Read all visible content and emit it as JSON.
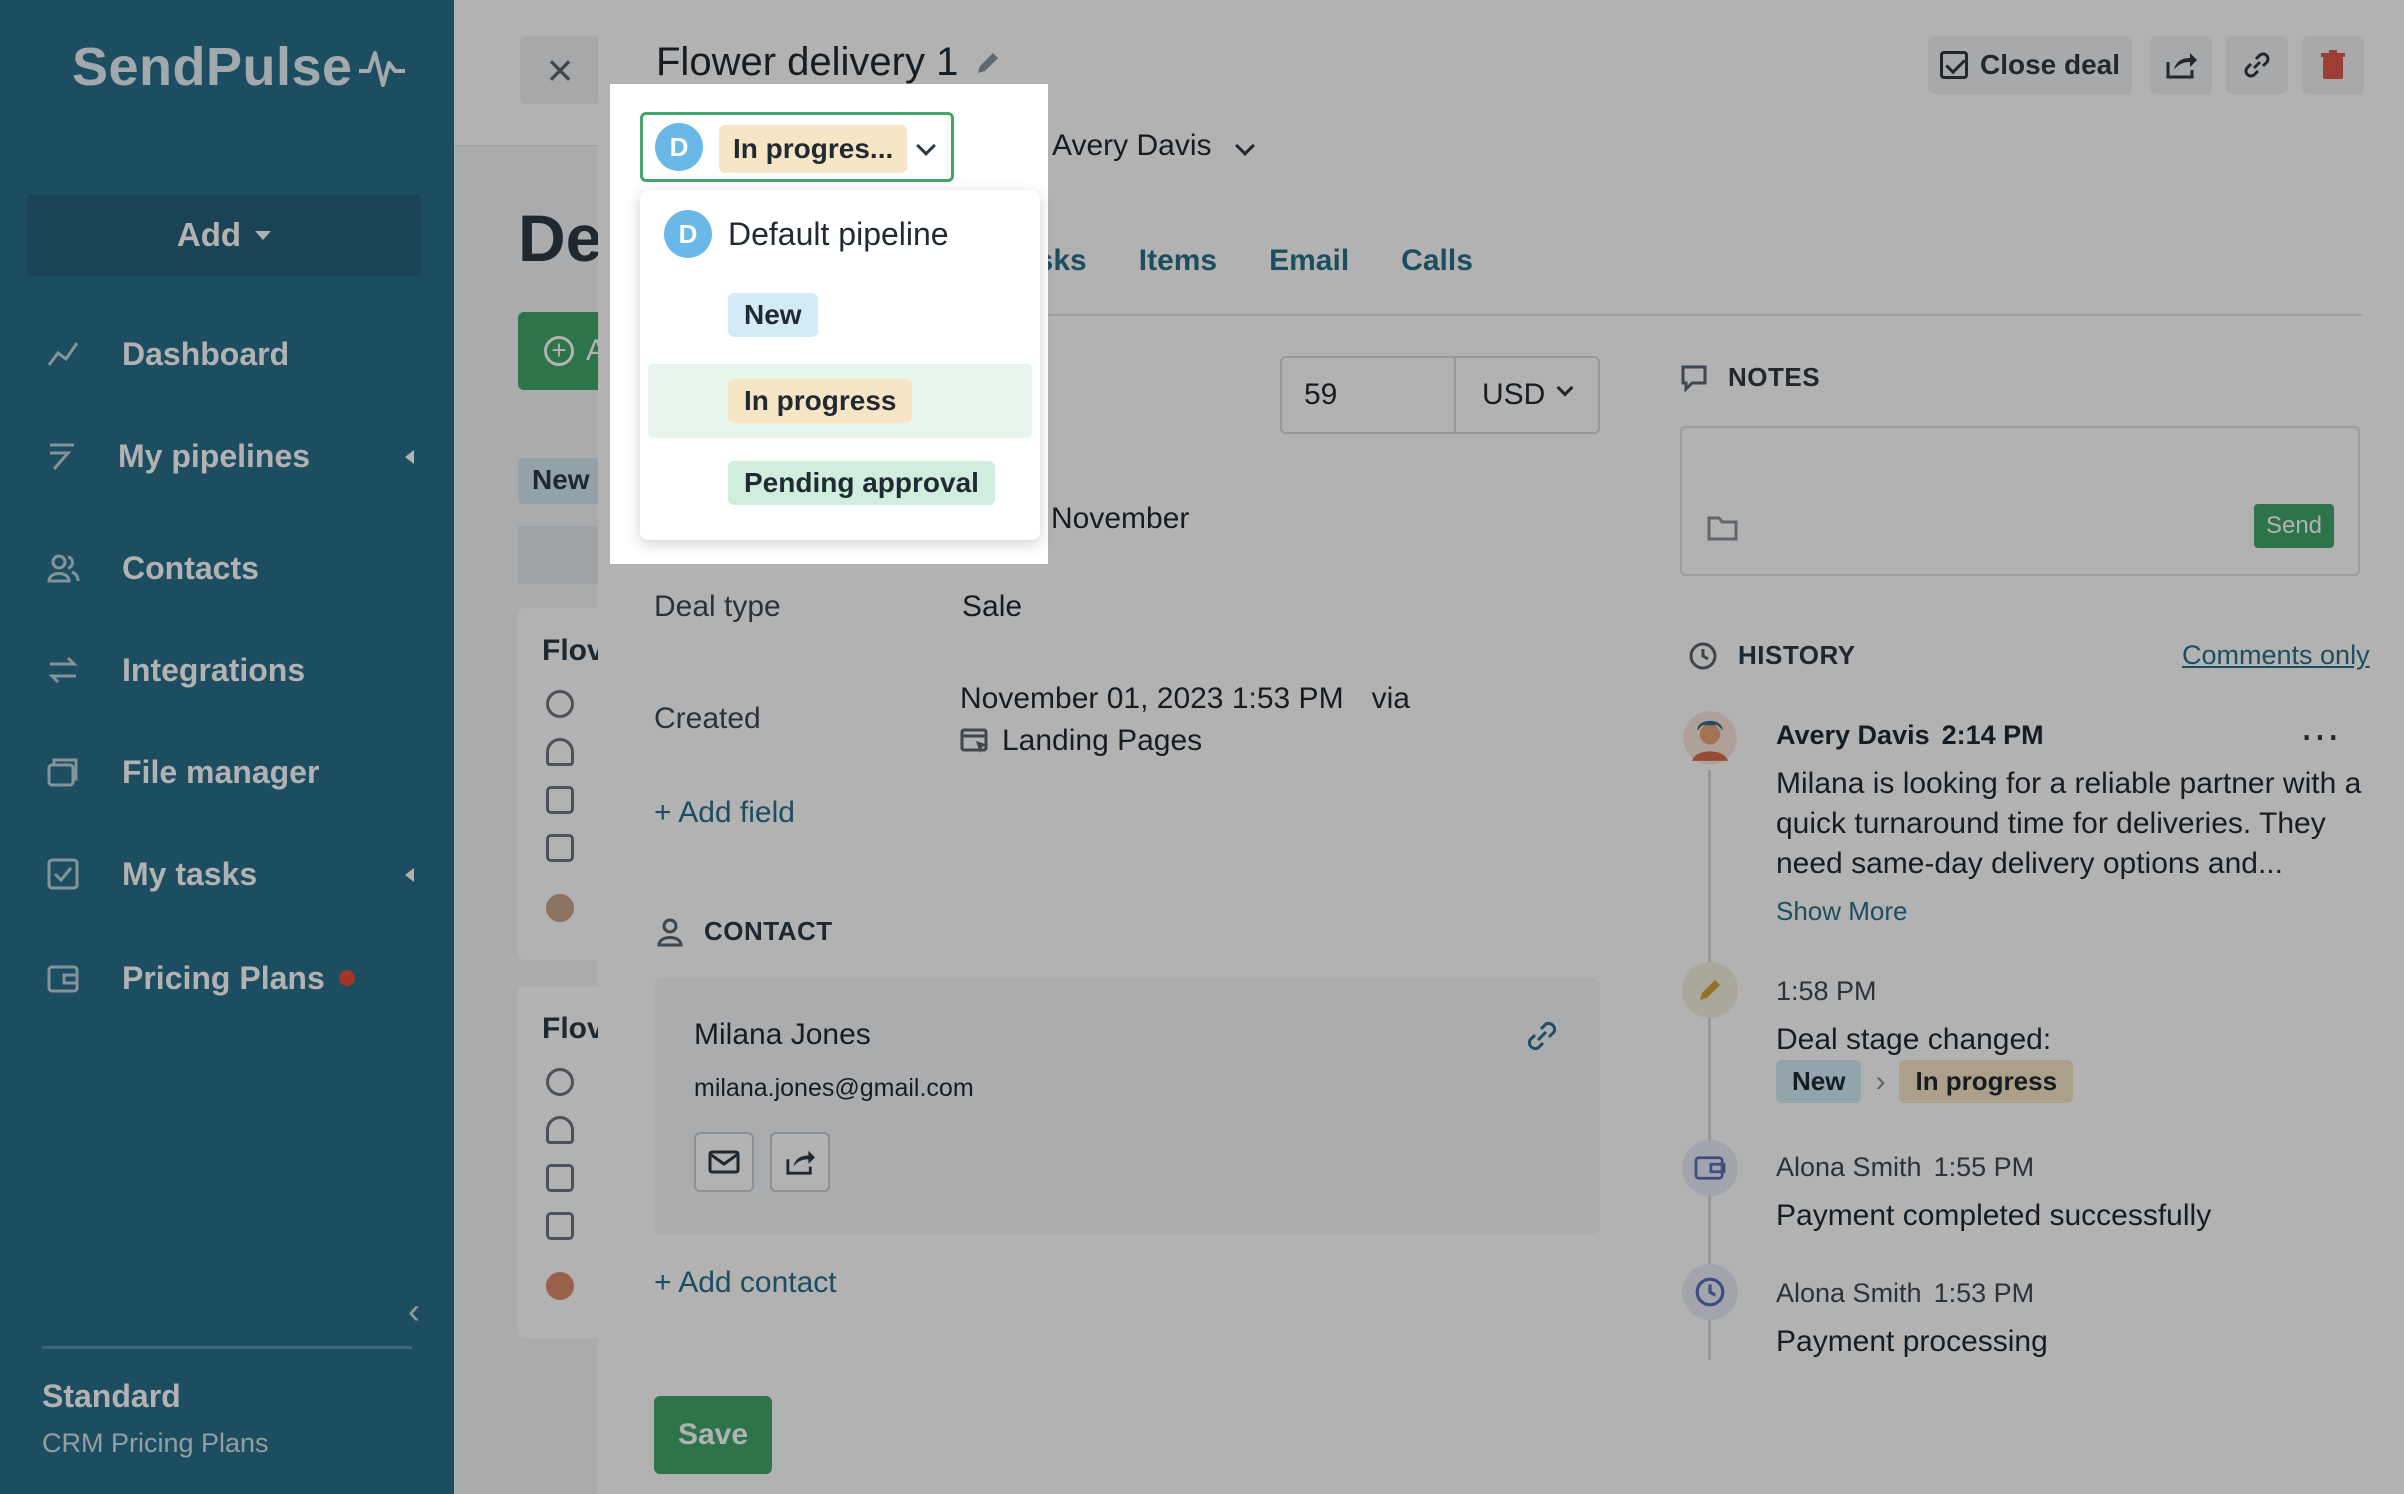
{
  "sidebar": {
    "logo": "SendPulse",
    "add_label": "Add",
    "items": [
      {
        "label": "Dashboard",
        "icon": "chart-line-icon",
        "submenu": false
      },
      {
        "label": "My pipelines",
        "icon": "pipelines-icon",
        "submenu": true
      },
      {
        "label": "Contacts",
        "icon": "contacts-icon",
        "submenu": false
      },
      {
        "label": "Integrations",
        "icon": "integrations-icon",
        "submenu": false
      },
      {
        "label": "File manager",
        "icon": "folder-icon",
        "submenu": false
      },
      {
        "label": "My tasks",
        "icon": "checkbox-icon",
        "submenu": true
      },
      {
        "label": "Pricing Plans",
        "icon": "wallet-icon",
        "submenu": false,
        "badge": true
      }
    ],
    "plan": {
      "name": "Standard",
      "sub": "CRM Pricing Plans"
    }
  },
  "background": {
    "title_partial": "De",
    "button_partial": "A",
    "tag_partial": "New",
    "card_titles": [
      "Flov",
      "Flov"
    ]
  },
  "deal": {
    "title": "Flower delivery 1",
    "actions": {
      "close_deal": "Close deal"
    },
    "owner": "Avery Davis",
    "tabs": [
      "asks",
      "Items",
      "Email",
      "Calls"
    ],
    "fields": {
      "amount": "59",
      "currency": "USD",
      "date_partial": "0 November",
      "deal_type_label": "Deal type",
      "deal_type_value": "Sale",
      "created_label": "Created",
      "created_value": "November 01, 2023 1:53 PM",
      "created_via": "via",
      "created_source": "Landing Pages",
      "add_field": "+ Add field"
    },
    "contact": {
      "heading": "CONTACT",
      "name": "Milana Jones",
      "email": "milana.jones@gmail.com",
      "add_contact": "+ Add contact"
    },
    "save": "Save"
  },
  "notes": {
    "heading": "NOTES",
    "send": "Send"
  },
  "history": {
    "heading": "HISTORY",
    "filter": "Comments only",
    "entries": [
      {
        "author": "Avery Davis",
        "time": "2:14 PM",
        "text": "Milana is looking for a reliable partner with a quick turnaround time for deliveries. They need same-day delivery options and...",
        "more": "Show More"
      },
      {
        "time": "1:58 PM",
        "text": "Deal stage changed:",
        "from": "New",
        "to": "In progress"
      },
      {
        "author": "Alona Smith",
        "time": "1:55 PM",
        "text": "Payment completed successfully"
      },
      {
        "author": "Alona Smith",
        "time": "1:53 PM",
        "text": "Payment processing"
      }
    ]
  },
  "stage_select": {
    "avatar_letter": "D",
    "current": "In progres...",
    "pipeline": "Default pipeline",
    "options": [
      {
        "label": "New",
        "color": "#d3ebf7"
      },
      {
        "label": "In progress",
        "color": "#f7e6c6"
      },
      {
        "label": "Pending approval",
        "color": "#cfeedd"
      }
    ]
  },
  "colors": {
    "sidebar": "#2a6f8b",
    "accent_green": "#42a66b",
    "link": "#2a6f8b"
  }
}
